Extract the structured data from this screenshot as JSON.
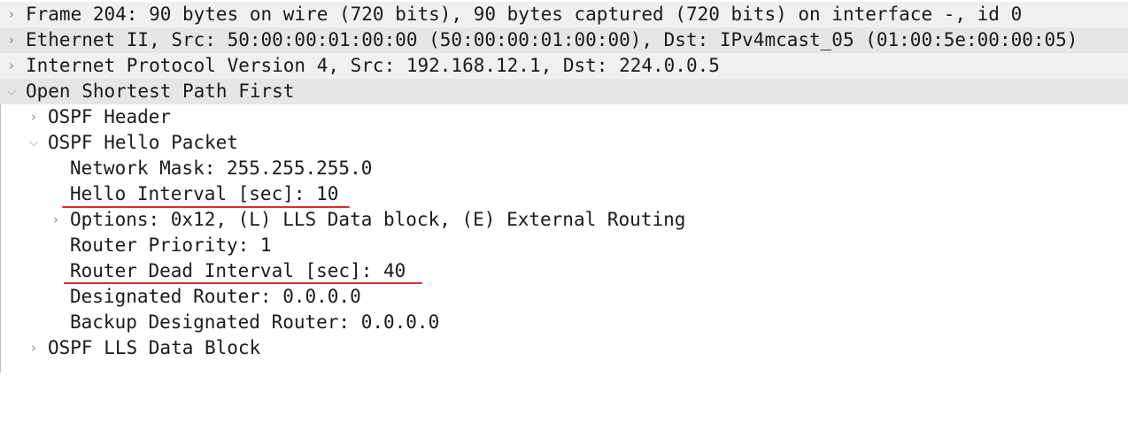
{
  "colors": {
    "top_row_bg": "#f0f0f0",
    "underline": "#e32b2b",
    "arrow": "#8a8a8a"
  },
  "icons": {
    "collapsed": "chevron-right-icon",
    "expanded": "chevron-down-icon"
  },
  "tree": {
    "frame": "Frame 204: 90 bytes on wire (720 bits), 90 bytes captured (720 bits) on interface -, id 0",
    "ethernet": "Ethernet II, Src: 50:00:00:01:00:00 (50:00:00:01:00:00), Dst: IPv4mcast_05 (01:00:5e:00:00:05)",
    "ip": "Internet Protocol Version 4, Src: 192.168.12.1, Dst: 224.0.0.5",
    "ospf": "Open Shortest Path First",
    "ospf_header": "OSPF Header",
    "hello_packet": "OSPF Hello Packet",
    "network_mask": "Network Mask: 255.255.255.0",
    "hello_interval": "Hello Interval [sec]: 10",
    "options": "Options: 0x12, (L) LLS Data block, (E) External Routing",
    "router_priority": "Router Priority: 1",
    "dead_interval": "Router Dead Interval [sec]: 40",
    "designated_router": "Designated Router: 0.0.0.0",
    "backup_designated_router": "Backup Designated Router: 0.0.0.0",
    "lls_block": "OSPF LLS Data Block"
  }
}
